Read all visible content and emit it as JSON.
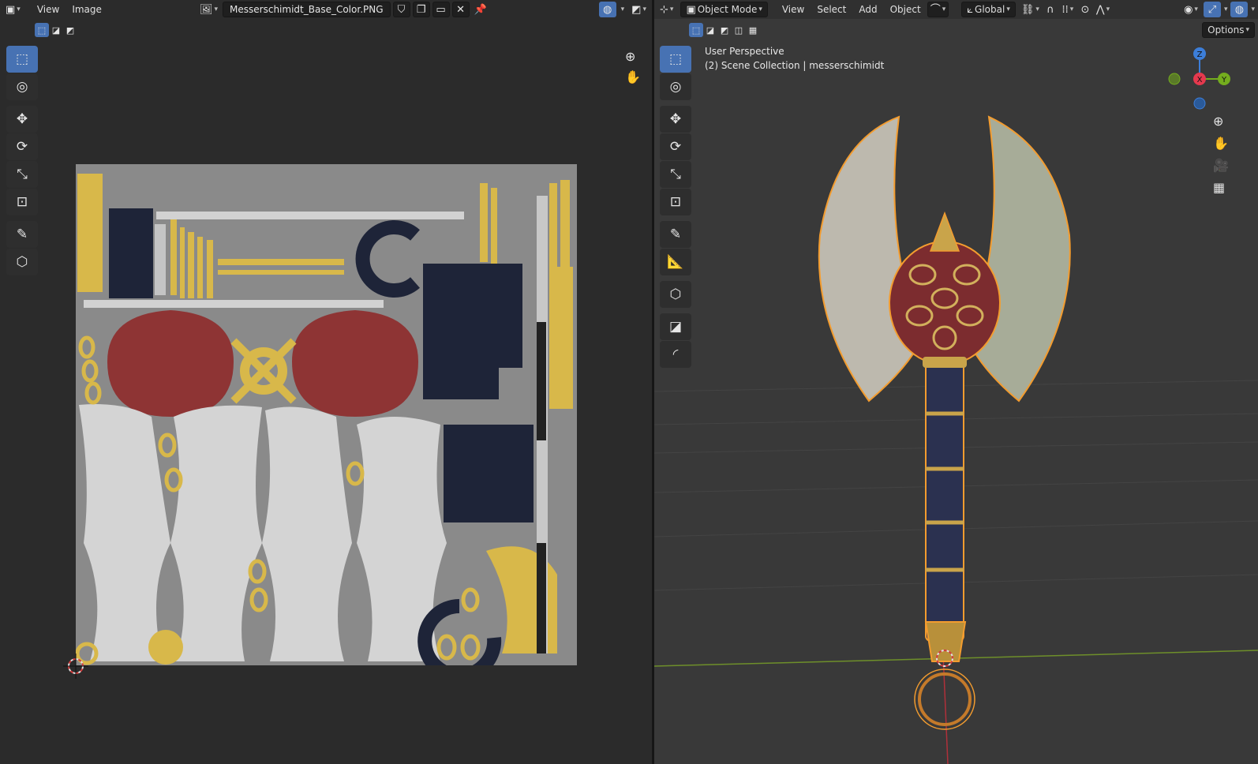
{
  "image_editor": {
    "header": {
      "menus": [
        "View",
        "Image"
      ],
      "image_name": "Messerschimidt_Base_Color.PNG"
    }
  },
  "viewport": {
    "header": {
      "mode": "Object Mode",
      "menus": [
        "View",
        "Select",
        "Add",
        "Object"
      ],
      "orientation": "Global",
      "options_label": "Options"
    },
    "overlay": {
      "perspective": "User Perspective",
      "collection": "(2) Scene Collection | messerschimidt"
    },
    "gizmo": {
      "z": "Z",
      "x": "X",
      "y": "Y"
    }
  },
  "colors": {
    "accent": "#4772b3",
    "selection_outline": "#f39c2f",
    "texture_gold": "#d8b84a",
    "texture_navy": "#1e2438",
    "texture_red": "#8e3434",
    "axis_x": "#e5394e",
    "axis_y": "#74ad1e",
    "axis_z": "#3c7ed9"
  }
}
